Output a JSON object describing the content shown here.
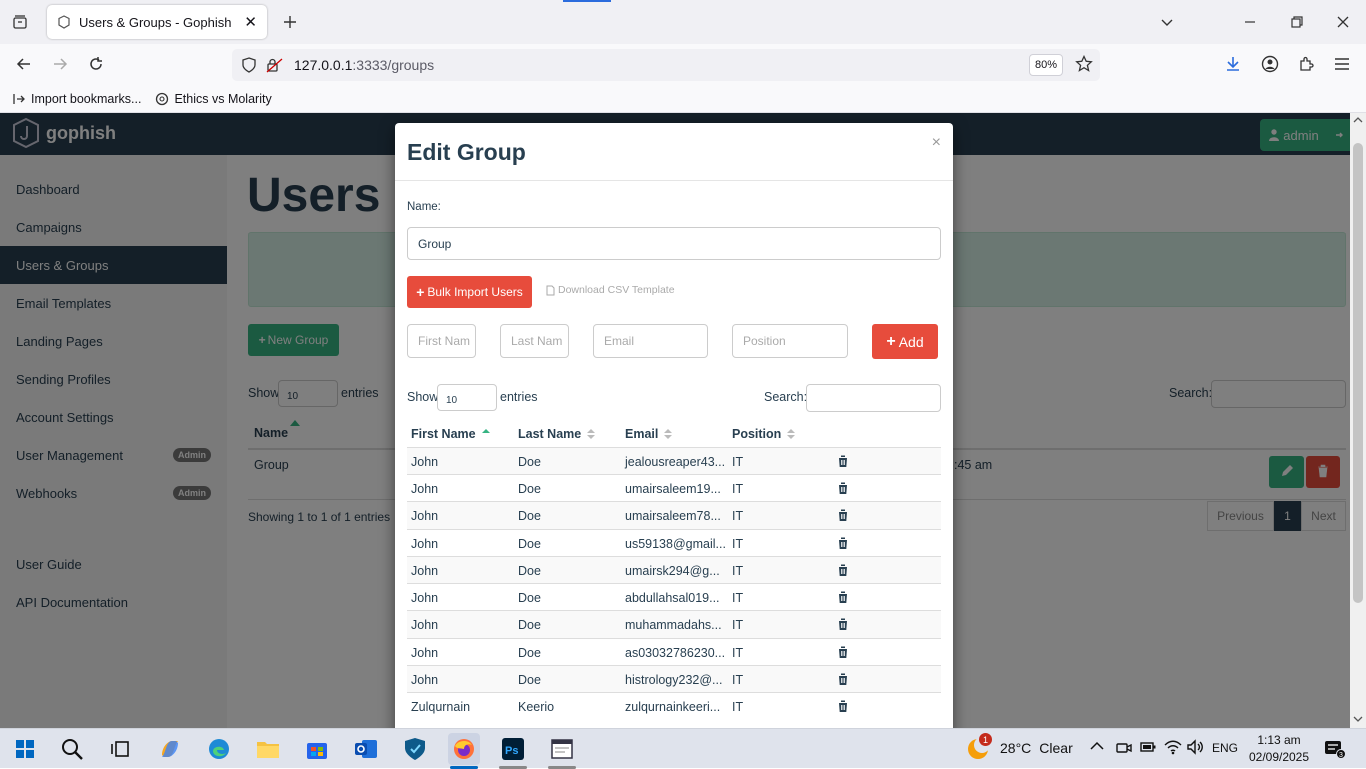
{
  "browser": {
    "tab_title": "Users & Groups - Gophish",
    "url_host": "127.0.0.1",
    "url_rest": ":3333/groups",
    "zoom": "80%",
    "bookmarks": [
      {
        "label": "Import bookmarks..."
      },
      {
        "label": "Ethics vs Molarity"
      }
    ]
  },
  "app": {
    "logo_text": "gophish",
    "admin_label": "admin",
    "page_title": "Users & Groups",
    "sidebar": [
      {
        "label": "Dashboard"
      },
      {
        "label": "Campaigns"
      },
      {
        "label": "Users & Groups",
        "active": true
      },
      {
        "label": "Email Templates"
      },
      {
        "label": "Landing Pages"
      },
      {
        "label": "Sending Profiles"
      },
      {
        "label": "Account Settings"
      },
      {
        "label": "User Management",
        "badge": "Admin"
      },
      {
        "label": "Webhooks",
        "badge": "Admin"
      },
      {
        "label": "User Guide"
      },
      {
        "label": "API Documentation"
      }
    ],
    "new_group_label": "New Group",
    "show_label": "Show",
    "entries_label": "entries",
    "entries_value": "10",
    "search_label": "Search:",
    "table_header_name": "Name",
    "row_name": "Group",
    "row_date_fragment": ":45 am",
    "showing_text": "Showing 1 to 1 of 1 entries",
    "pager": {
      "previous": "Previous",
      "current": "1",
      "next": "Next"
    }
  },
  "modal": {
    "title": "Edit Group",
    "close": "×",
    "name_label": "Name:",
    "name_value": "Group",
    "bulk_import_label": "Bulk Import Users",
    "csv_template_label": "Download CSV Template",
    "first_name_placeholder": "First Nam",
    "last_name_placeholder": "Last Nam",
    "email_placeholder": "Email",
    "position_placeholder": "Position",
    "add_label": "Add",
    "show_label": "Show",
    "entries_value": "10",
    "entries_label": "entries",
    "search_label": "Search:",
    "columns": [
      "First Name",
      "Last Name",
      "Email",
      "Position"
    ],
    "rows": [
      {
        "first": "John",
        "last": "Doe",
        "email": "jealousreaper43...",
        "position": "IT"
      },
      {
        "first": "John",
        "last": "Doe",
        "email": "umairsaleem19...",
        "position": "IT"
      },
      {
        "first": "John",
        "last": "Doe",
        "email": "umairsaleem78...",
        "position": "IT"
      },
      {
        "first": "John",
        "last": "Doe",
        "email": "us59138@gmail...",
        "position": "IT"
      },
      {
        "first": "John",
        "last": "Doe",
        "email": "umairsk294@g...",
        "position": "IT"
      },
      {
        "first": "John",
        "last": "Doe",
        "email": "abdullahsal019...",
        "position": "IT"
      },
      {
        "first": "John",
        "last": "Doe",
        "email": "muhammadahs...",
        "position": "IT"
      },
      {
        "first": "John",
        "last": "Doe",
        "email": "as03032786230...",
        "position": "IT"
      },
      {
        "first": "John",
        "last": "Doe",
        "email": "histrology232@...",
        "position": "IT"
      },
      {
        "first": "Zulqurnain",
        "last": "Keerio",
        "email": "zulqurnainkeeri...",
        "position": "IT"
      }
    ]
  },
  "taskbar": {
    "weather_temp": "28°C",
    "weather_text": "Clear",
    "weather_badge": "1",
    "language": "ENG",
    "time": "1:13 am",
    "date": "02/09/2025"
  },
  "colors": {
    "brand_dark": "#283f50",
    "brand_green": "#37b483",
    "danger": "#e74c3c"
  }
}
